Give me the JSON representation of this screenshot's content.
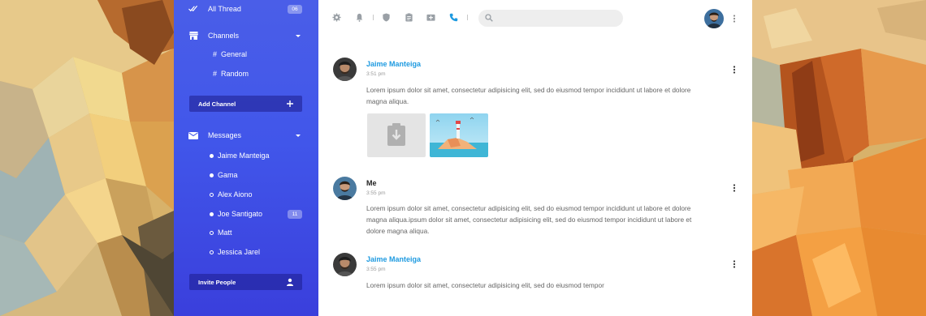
{
  "sidebar": {
    "all_thread": {
      "label": "All Thread",
      "badge": "06"
    },
    "channels": {
      "label": "Channels",
      "items": [
        {
          "hash": "#",
          "label": "General"
        },
        {
          "hash": "#",
          "label": "Random"
        }
      ],
      "add_button": "Add Channel"
    },
    "messages": {
      "label": "Messages",
      "contacts": [
        {
          "name": "Jaime Manteiga",
          "online": true,
          "badge": ""
        },
        {
          "name": "Gama",
          "online": true,
          "badge": ""
        },
        {
          "name": "Alex Aiono",
          "online": false,
          "badge": ""
        },
        {
          "name": "Joe Santigato",
          "online": true,
          "badge": "11"
        },
        {
          "name": "Matt",
          "online": false,
          "badge": ""
        },
        {
          "name": "Jessica Jarel",
          "online": false,
          "badge": ""
        }
      ],
      "invite_button": "Invite People"
    }
  },
  "toolbar": {
    "icons": [
      "gear-icon",
      "bell-icon",
      "shield-icon",
      "clipboard-icon",
      "mail-plus-icon",
      "phone-icon"
    ],
    "active_icon": "phone-icon",
    "search_placeholder": ""
  },
  "messages": [
    {
      "sender": "Jaime Manteiga",
      "time": "3:51 pm",
      "text": "Lorem ipsum dolor sit amet, consectetur adipisicing elit, sed do eiusmod tempor incididunt ut labore et dolore magna aliqua.",
      "attachments": [
        "download-placeholder",
        "lighthouse-image"
      ]
    },
    {
      "sender": "Me",
      "time": "3:55 pm",
      "text": "Lorem ipsum dolor sit amet, consectetur adipisicing elit, sed do eiusmod tempor incididunt ut labore et dolore magna aliqua.ipsum dolor sit amet, consectetur adipisicing elit, sed do eiusmod tempor incididunt ut labore et dolore magna aliqua."
    },
    {
      "sender": "Jaime Manteiga",
      "time": "3:55 pm",
      "text": "Lorem ipsum dolor sit amet, consectetur adipisicing elit, sed do eiusmod tempor"
    }
  ],
  "colors": {
    "sidebar_top": "#4a5ee8",
    "sidebar_bottom": "#3a3fdc",
    "accent": "#1e9ae0",
    "panel": "#ffffff"
  }
}
